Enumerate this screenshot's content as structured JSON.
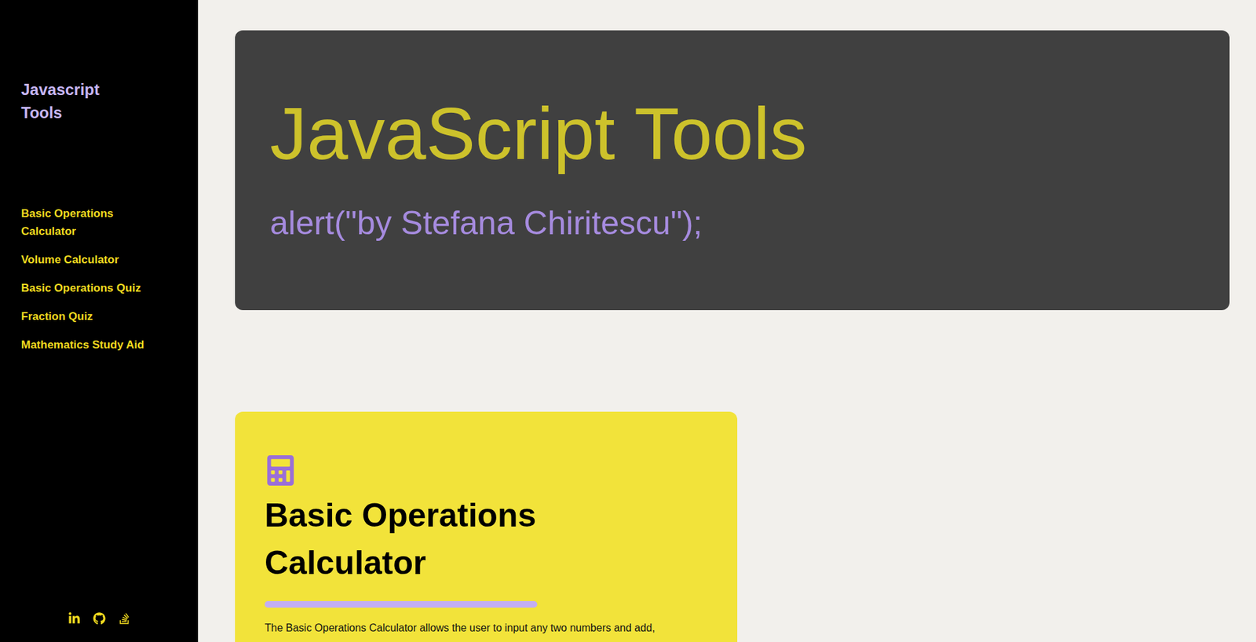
{
  "sidebar": {
    "title": "Javascript Tools",
    "items": [
      {
        "label": "Basic Operations Calculator"
      },
      {
        "label": "Volume Calculator"
      },
      {
        "label": "Basic Operations Quiz"
      },
      {
        "label": "Fraction Quiz"
      },
      {
        "label": "Mathematics Study Aid"
      }
    ]
  },
  "hero": {
    "title": "JavaScript Tools",
    "subtitle": "alert(\"by Stefana Chiritescu\");"
  },
  "card": {
    "title": "Basic Operations Calculator",
    "description": "The Basic Operations Calculator allows the user to input any two numbers and add,"
  }
}
